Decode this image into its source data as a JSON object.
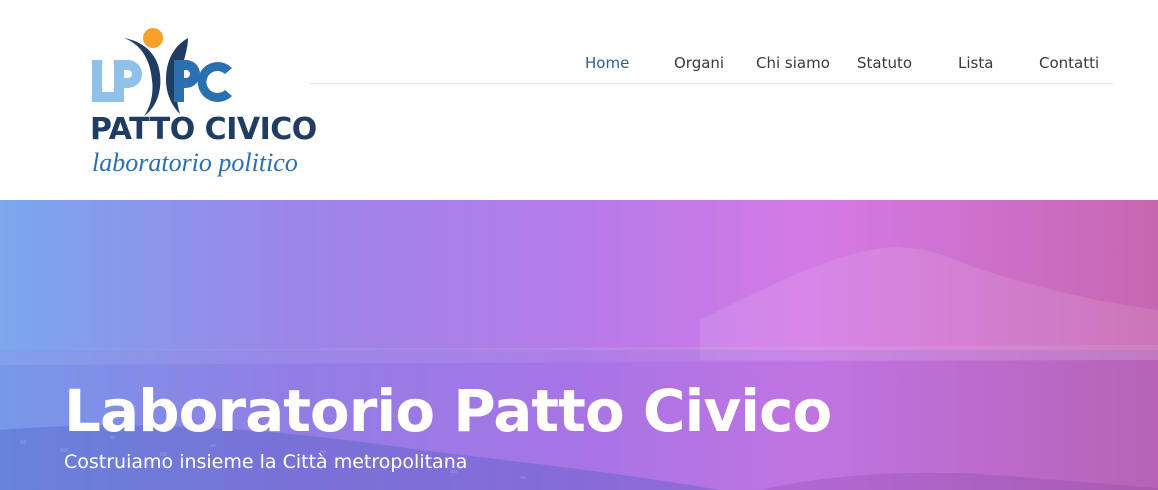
{
  "brand": {
    "logo_letters": "LPPC",
    "title": "PATTO CIVICO",
    "subtitle": "laboratorio politico",
    "colors": {
      "navy": "#1f3d63",
      "light_blue": "#8fc1ea",
      "blue": "#2a6fb0",
      "orange": "#f5a12a"
    }
  },
  "nav": {
    "items": [
      {
        "label": "Home",
        "active": true
      },
      {
        "label": "Organi",
        "active": false
      },
      {
        "label": "Chi siamo",
        "active": false
      },
      {
        "label": "Statuto",
        "active": false
      },
      {
        "label": "Lista",
        "active": false
      },
      {
        "label": "Contatti",
        "active": false
      }
    ],
    "active_color": "#2c5f8e"
  },
  "hero": {
    "title": "Laboratorio Patto Civico",
    "subtitle": "Costruiamo insieme la Città metropolitana",
    "gradient": [
      "#7aa7ee",
      "#b57be9",
      "#d47ae6",
      "#c766b0"
    ]
  }
}
